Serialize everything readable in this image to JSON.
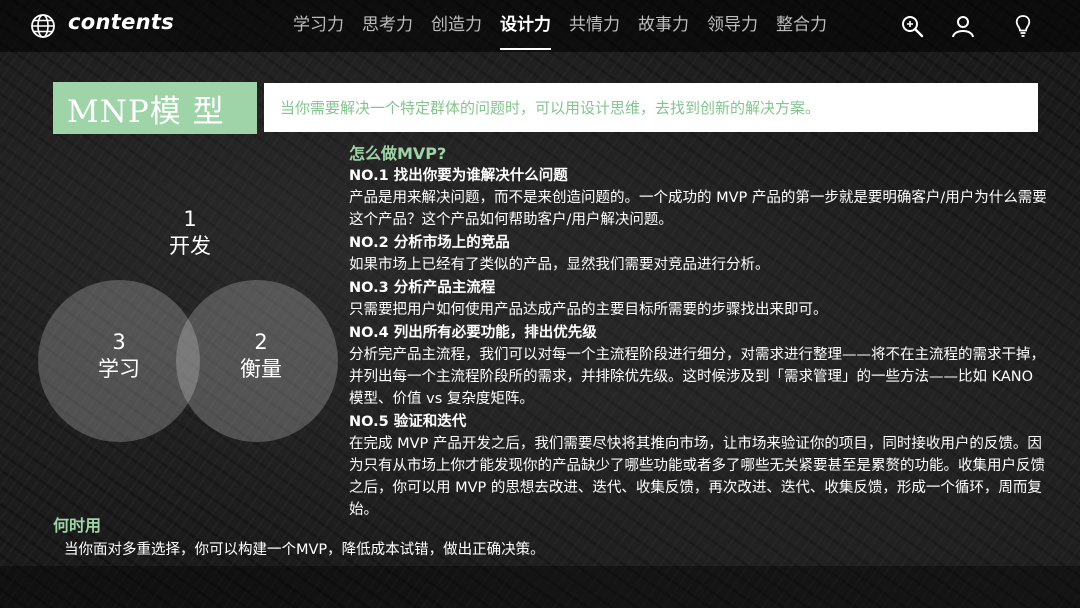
{
  "nav": {
    "logo_text": "contents",
    "items": [
      "学习力",
      "思考力",
      "创造力",
      "设计力",
      "共情力",
      "故事力",
      "领导力",
      "整合力"
    ],
    "active_index": 3,
    "icons": [
      "search-icon",
      "user-icon",
      "lightbulb-icon"
    ]
  },
  "title": {
    "text": "MNP模 型",
    "subtitle": "当你需要解决一个特定群体的问题时，可以用设计思维，去找到创新的解决方案。"
  },
  "venn": {
    "develop": {
      "num": "1",
      "name": "开发"
    },
    "learn": {
      "num": "3",
      "name": "学习"
    },
    "measure": {
      "num": "2",
      "name": "衡量"
    }
  },
  "content": {
    "heading": "怎么做MVP?",
    "steps": [
      {
        "title": "NO.1 找出你要为谁解决什么问题",
        "body": "产品是用来解决问题，而不是来创造问题的。一个成功的 MVP 产品的第一步就是要明确客户/用户为什么需要这个产品？这个产品如何帮助客户/用户解决问题。"
      },
      {
        "title": "NO.2 分析市场上的竞品",
        "body": "如果市场上已经有了类似的产品，显然我们需要对竞品进行分析。"
      },
      {
        "title": "NO.3 分析产品主流程",
        "body": "只需要把用户如何使用产品达成产品的主要目标所需要的步骤找出来即可。"
      },
      {
        "title": "NO.4 列出所有必要功能，排出优先级",
        "body": "分析完产品主流程，我们可以对每一个主流程阶段进行细分，对需求进行整理——将不在主流程的需求干掉，并列出每一个主流程阶段所的需求，并排除优先级。这时候涉及到「需求管理」的一些方法——比如 KANO 模型、价值 vs 复杂度矩阵。"
      },
      {
        "title": "NO.5 验证和迭代",
        "body": "在完成 MVP 产品开发之后，我们需要尽快将其推向市场，让市场来验证你的项目，同时接收用户的反馈。因为只有从市场上你才能发现你的产品缺少了哪些功能或者多了哪些无关紧要甚至是累赘的功能。收集用户反馈之后，你可以用 MVP 的思想去改进、迭代、收集反馈，再次改进、迭代、收集反馈，形成一个循环，周而复始。"
      }
    ]
  },
  "when": {
    "heading": "何时用",
    "text": "当你面对多重选择，你可以构建一个MVP，降低成本试错，做出正确决策。"
  },
  "colors": {
    "accent_green": "#9fd4a8",
    "text_green": "#84c48f",
    "background": "#1b1b1b"
  }
}
